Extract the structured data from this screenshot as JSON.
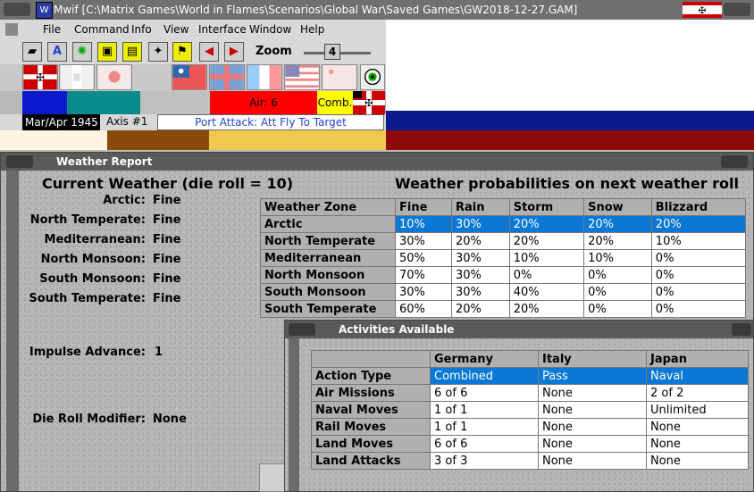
{
  "window": {
    "title": "Mwif [C:\\Matrix Games\\World in Flames\\Scenarios\\Global War\\Saved Games\\GW2018-12-27.GAM]"
  },
  "menu": [
    "File",
    "Command",
    "Info",
    "View",
    "Interface",
    "Window",
    "Help"
  ],
  "toolbar": {
    "zoom_label": "Zoom",
    "zoom_value": "4"
  },
  "status": {
    "date": "Mar/Apr 1945",
    "phase": "Axis #1",
    "message": "Port Attack: Att Fly To Target",
    "air_label": "Air: 6",
    "comb_label": "Comb."
  },
  "weather_window": {
    "title": "Weather Report"
  },
  "current_weather": {
    "heading": "Current Weather (die roll = 10)",
    "zones": [
      {
        "label": "Arctic:",
        "value": "Fine"
      },
      {
        "label": "North Temperate:",
        "value": "Fine"
      },
      {
        "label": "Mediterranean:",
        "value": "Fine"
      },
      {
        "label": "North Monsoon:",
        "value": "Fine"
      },
      {
        "label": "South Monsoon:",
        "value": "Fine"
      },
      {
        "label": "South Temperate:",
        "value": "Fine"
      }
    ],
    "impulse_label": "Impulse Advance:",
    "impulse_value": "1",
    "die_label": "Die Roll Modifier:",
    "die_value": "None"
  },
  "probabilities": {
    "heading": "Weather probabilities on next weather roll",
    "columns": [
      "Weather Zone",
      "Fine",
      "Rain",
      "Storm",
      "Snow",
      "Blizzard"
    ],
    "rows": [
      [
        "Arctic",
        "10%",
        "30%",
        "20%",
        "20%",
        "20%"
      ],
      [
        "North Temperate",
        "30%",
        "20%",
        "20%",
        "20%",
        "10%"
      ],
      [
        "Mediterranean",
        "50%",
        "30%",
        "10%",
        "10%",
        "0%"
      ],
      [
        "North Monsoon",
        "70%",
        "30%",
        "0%",
        "0%",
        "0%"
      ],
      [
        "South Monsoon",
        "30%",
        "30%",
        "40%",
        "0%",
        "0%"
      ],
      [
        "South Temperate",
        "60%",
        "20%",
        "20%",
        "0%",
        "0%"
      ]
    ]
  },
  "activities": {
    "title": "Activities Available",
    "columns": [
      "",
      "Germany",
      "Italy",
      "Japan"
    ],
    "rows": [
      [
        "Action Type",
        "Combined",
        "Pass",
        "Naval"
      ],
      [
        "Air Missions",
        "6 of 6",
        "None",
        "2 of 2"
      ],
      [
        "Naval Moves",
        "1 of 1",
        "None",
        "Unlimited"
      ],
      [
        "Rail Moves",
        "1 of 1",
        "None",
        "None"
      ],
      [
        "Land Moves",
        "6 of 6",
        "None",
        "None"
      ],
      [
        "Land Attacks",
        "3 of 3",
        "None",
        "None"
      ]
    ]
  },
  "colors": {
    "selection": "#0a78d7",
    "air_red": "#ff0000",
    "comb_yellow": "#ffff00",
    "stripe_navy": "#0a1a8c",
    "stripe_maroon": "#8c0a0a"
  }
}
